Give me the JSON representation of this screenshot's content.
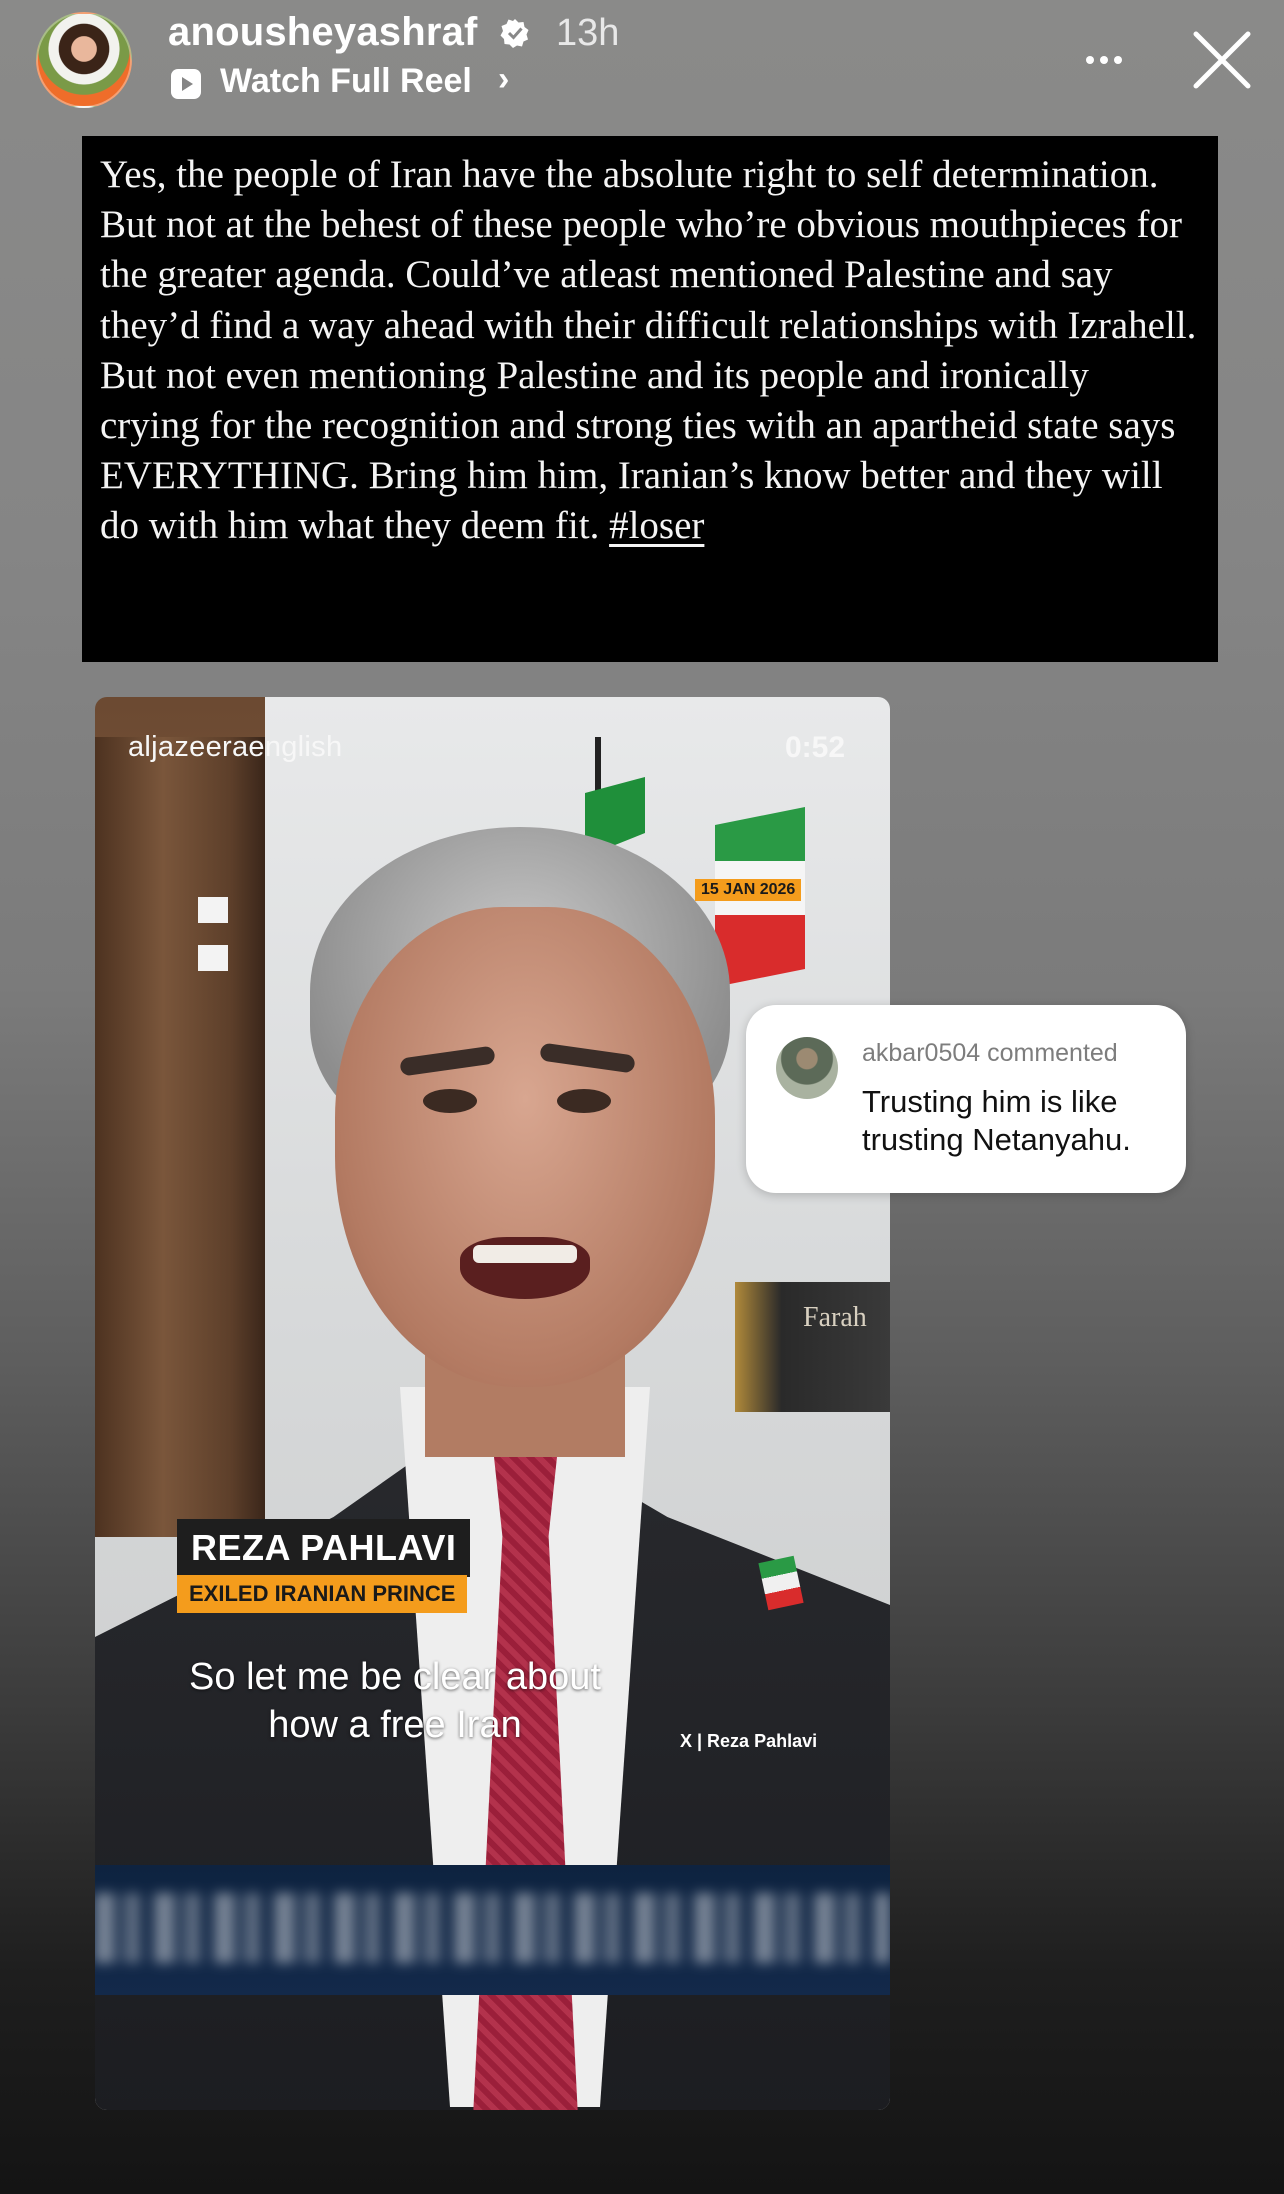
{
  "header": {
    "username": "anousheyashraf",
    "time": "13h",
    "watch_full_reel": "Watch Full Reel",
    "chevron": "›"
  },
  "caption": {
    "text": "Yes, the people of Iran have the absolute right to self determination. But not at the behest of these people who’re obvious mouthpieces for the greater agenda. Could’ve atleast mentioned Palestine and say they’d find a way ahead with their difficult relationships with Izrahell. But not even mentioning Palestine and its people and ironically crying for the recognition and strong ties with an apartheid state says EVERYTHING. Bring him him, Iranian’s know better and they will do with him what they deem fit.",
    "hashtag": "#loser"
  },
  "reel": {
    "source_handle": "aljazeeraenglish",
    "duration": "0:52",
    "date": "15 JAN 2026",
    "book_title": "Farah",
    "name": "REZA PAHLAVI",
    "title": "EXILED IRANIAN PRINCE",
    "subtitle": "So let me be clear about how a free Iran",
    "credit": "X | Reza Pahlavi"
  },
  "comment": {
    "user": "akbar0504 commented",
    "text": "Trusting him is like trusting Netanyahu."
  },
  "icons": {
    "verified": "verified-badge-icon",
    "reel": "reel-play-icon",
    "more": "more-options-icon",
    "close": "close-icon"
  },
  "colors": {
    "badge_orange": "#f49c1c",
    "caption_bg": "#000000"
  }
}
